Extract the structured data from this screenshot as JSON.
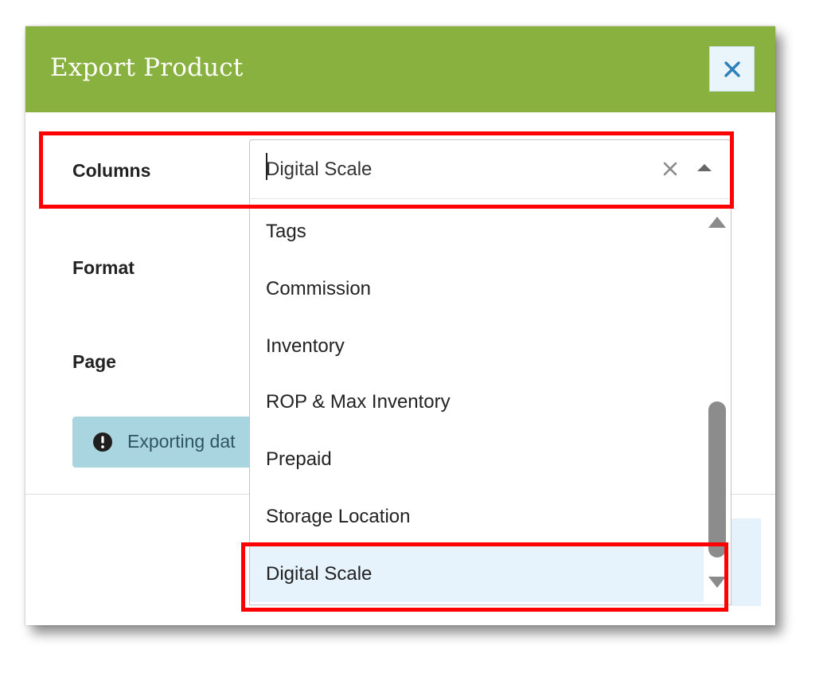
{
  "dialog": {
    "title": "Export Product",
    "close_icon": "close-x-icon",
    "accent_color": "#88b13f"
  },
  "form": {
    "columns_label": "Columns",
    "format_label": "Format",
    "page_label": "Page"
  },
  "columns_select": {
    "value": "Digital Scale",
    "clear_icon": "clear-x-icon",
    "toggle_icon": "caret-up-icon",
    "expanded": true
  },
  "dropdown": {
    "options": [
      {
        "label": "Tags"
      },
      {
        "label": "Commission"
      },
      {
        "label": "Inventory"
      },
      {
        "label": "ROP & Max Inventory"
      },
      {
        "label": "Prepaid"
      },
      {
        "label": "Storage Location"
      },
      {
        "label": "Digital Scale",
        "selected": true
      }
    ],
    "scroll_up_icon": "scroll-up-arrow-icon",
    "scroll_down_icon": "scroll-down-arrow-icon"
  },
  "alert": {
    "icon": "exclamation-circle-icon",
    "text": "Exporting dat",
    "color": "#a9d5e0"
  },
  "annotations": {
    "highlight_color": "#ff0000"
  }
}
